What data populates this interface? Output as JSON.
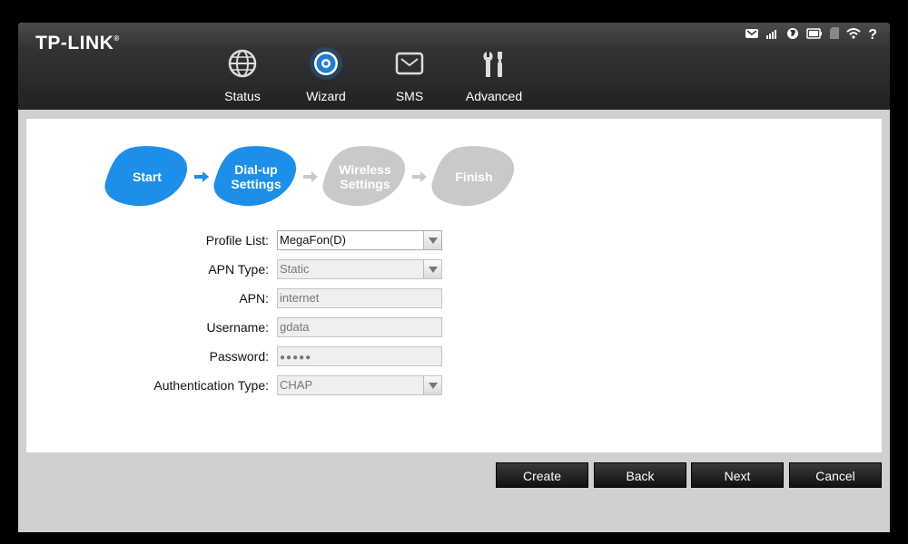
{
  "brand": {
    "logo": "TP-LINK",
    "registered": "®"
  },
  "nav": {
    "items": [
      {
        "label": "Status",
        "icon": "globe-icon"
      },
      {
        "label": "Wizard",
        "icon": "gear-icon",
        "active": true
      },
      {
        "label": "SMS",
        "icon": "envelope-icon"
      },
      {
        "label": "Advanced",
        "icon": "tools-icon"
      }
    ]
  },
  "status_bar": {
    "icons": [
      "mail-icon",
      "signal-icon",
      "internet-icon",
      "battery-icon",
      "sd-card-icon",
      "wifi-icon",
      "help-icon"
    ],
    "help_glyph": "?"
  },
  "wizard": {
    "steps": [
      {
        "label_line1": "Start",
        "label_line2": "",
        "state": "done"
      },
      {
        "label_line1": "Dial-up",
        "label_line2": "Settings",
        "state": "current"
      },
      {
        "label_line1": "Wireless",
        "label_line2": "Settings",
        "state": "pending"
      },
      {
        "label_line1": "Finish",
        "label_line2": "",
        "state": "pending"
      }
    ],
    "colors": {
      "active": "#1e8fe8",
      "inactive": "#c9c9c9",
      "arrow_active": "#1e8fe8",
      "arrow_inactive": "#c9c9c9"
    }
  },
  "form": {
    "profile_list": {
      "label": "Profile List:",
      "value": "MegaFon(D)"
    },
    "apn_type": {
      "label": "APN Type:",
      "value": "Static"
    },
    "apn": {
      "label": "APN:",
      "value": "internet"
    },
    "username": {
      "label": "Username:",
      "value": "gdata"
    },
    "password": {
      "label": "Password:",
      "value": "●●●●●"
    },
    "auth_type": {
      "label": "Authentication Type:",
      "value": "CHAP"
    }
  },
  "buttons": {
    "create": "Create",
    "back": "Back",
    "next": "Next",
    "cancel": "Cancel"
  }
}
